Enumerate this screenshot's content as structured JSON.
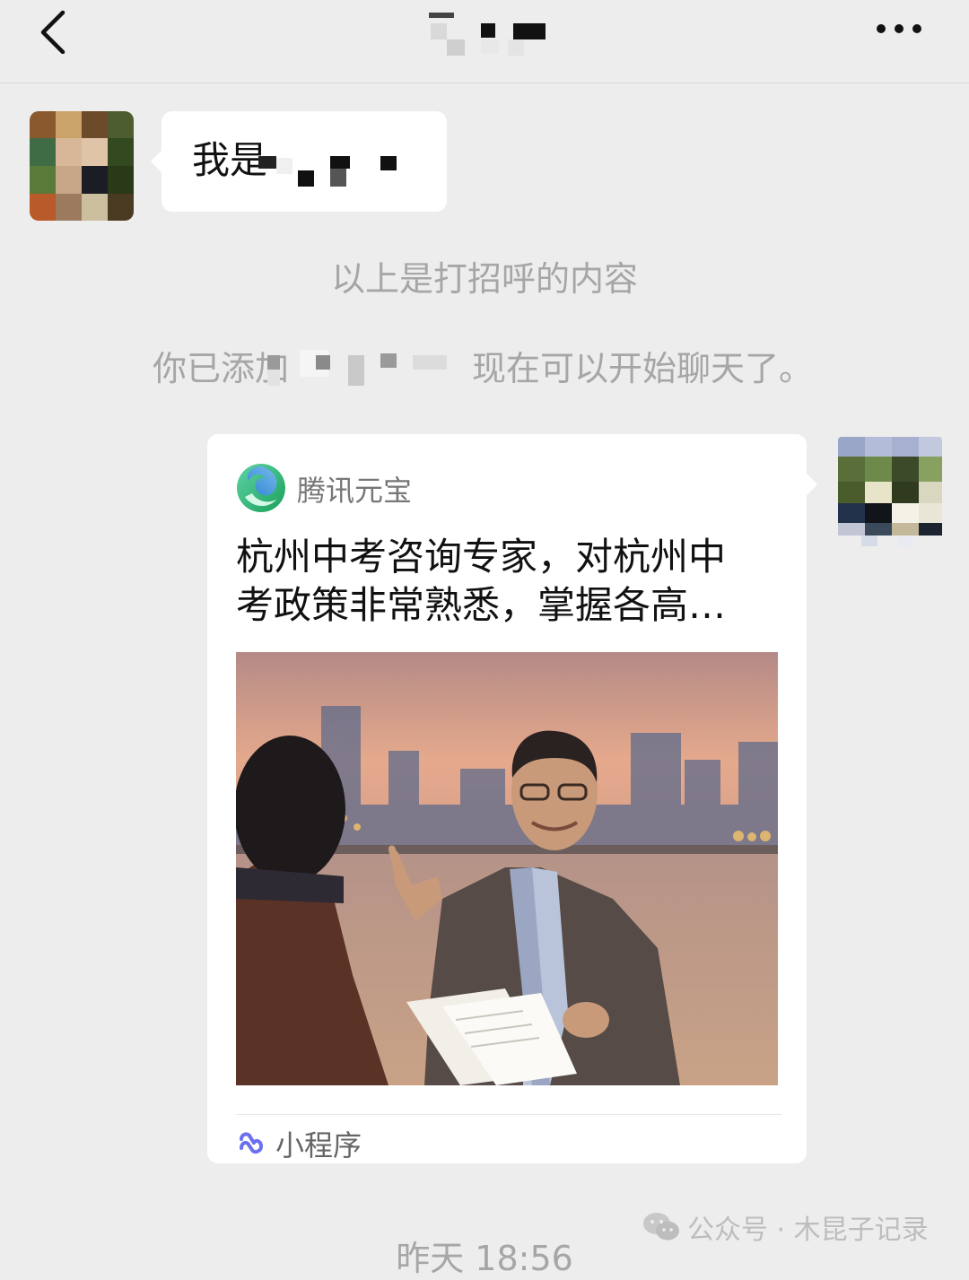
{
  "header": {
    "title": "",
    "back_icon": "chevron-left-icon",
    "more_icon": "more-horizontal-icon"
  },
  "messages": {
    "incoming": {
      "text": "我是"
    },
    "system_greeting_note": "以上是打招呼的内容",
    "system_added_prefix": "你已添加",
    "system_added_suffix": "现在可以开始聊天了。"
  },
  "mini_program_card": {
    "app_name": "腾讯元宝",
    "title_line1": "杭州中考咨询专家，对杭州中",
    "title_line2": "考政策非常熟悉，掌握各高…",
    "footer_label": "小程序",
    "footer_icon": "mini-program-icon"
  },
  "timestamp": "昨天 18:56",
  "watermark": {
    "icon": "wechat-icon",
    "text": "公众号 · 木昆子记录"
  },
  "colors": {
    "background": "#ededed",
    "bubble": "#ffffff",
    "system_text": "#a6a6a6",
    "text": "#111111"
  }
}
